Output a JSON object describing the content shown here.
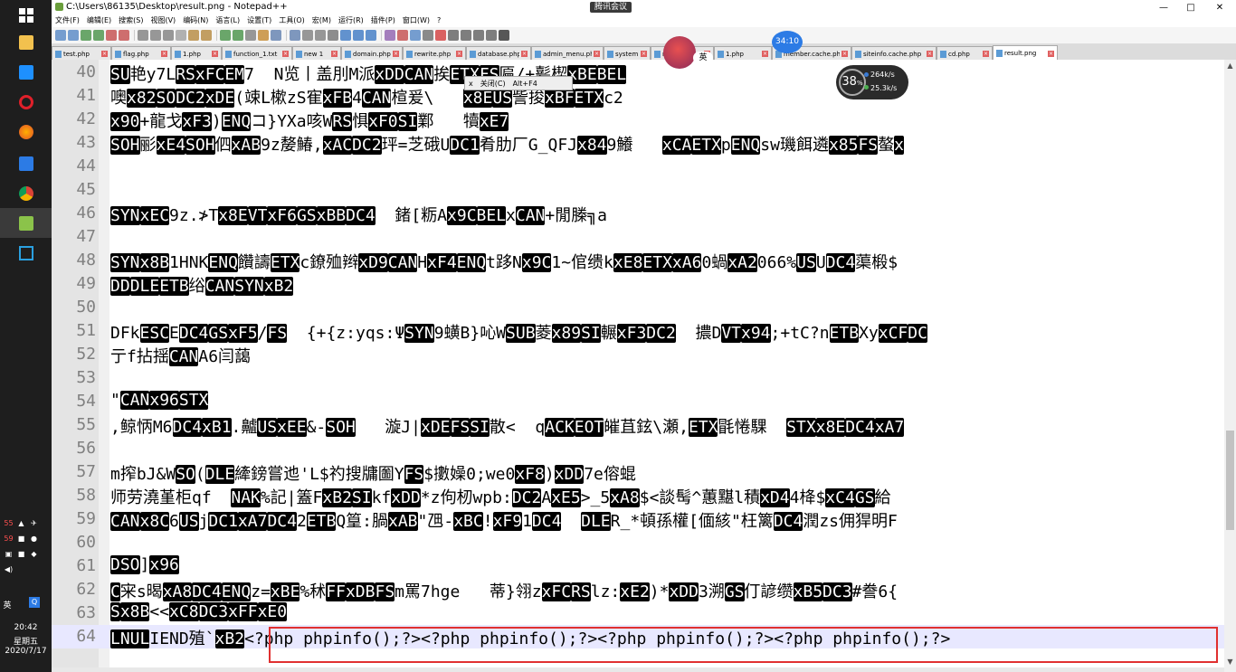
{
  "taskbar": {
    "tray_time": "20:42",
    "tray_weekday": "星期五",
    "tray_date": "2020/7/17",
    "ime": "英",
    "badge_a": "55",
    "badge_b": "59"
  },
  "window": {
    "title": "C:\\Users\\86135\\Desktop\\result.png - Notepad++",
    "meeting_label": "腾讯会议",
    "min": "—",
    "max": "□",
    "close": "✕"
  },
  "menu": [
    "文件(F)",
    "编辑(E)",
    "搜索(S)",
    "视图(V)",
    "编码(N)",
    "语言(L)",
    "设置(T)",
    "工具(O)",
    "宏(M)",
    "运行(R)",
    "插件(P)",
    "窗口(W)",
    "?"
  ],
  "tabs": [
    {
      "label": "test.php"
    },
    {
      "label": "flag.php"
    },
    {
      "label": "1.php"
    },
    {
      "label": "function_1.txt"
    },
    {
      "label": "new 1"
    },
    {
      "label": "domain.php"
    },
    {
      "label": "rewrite.php"
    },
    {
      "label": "database.php"
    },
    {
      "label": "admin_menu.php"
    },
    {
      "label": "system"
    },
    {
      "label": "m.php"
    },
    {
      "label": "1.php"
    },
    {
      "label": "member.cache.php"
    },
    {
      "label": "siteinfo.cache.php"
    },
    {
      "label": "cd.php"
    },
    {
      "label": "result.png"
    }
  ],
  "overlay": {
    "speed_pct": "38",
    "speed_pct_unit": "%",
    "speed_up": "264k/s",
    "speed_down": "25.3k/s",
    "ctx_label": "关闭(C)",
    "ctx_shortcut": "Alt+F4",
    "ctx_x": "x",
    "avatar_badge": "英",
    "timer": "34:10"
  },
  "lines": [
    {
      "n": "40",
      "segs": [
        [
          "b",
          "SU"
        ],
        [
          "t",
          "艳y7L"
        ],
        [
          "b",
          "RS"
        ],
        [
          "b",
          "xFC"
        ],
        [
          "b",
          "EM"
        ],
        [
          "t",
          "7  N览丨盖刖M派"
        ],
        [
          "b",
          "xDD"
        ],
        [
          "b",
          "CAN"
        ],
        [
          "t",
          "挨"
        ],
        [
          "b",
          "ETX"
        ],
        [
          "b",
          "FS"
        ],
        [
          "t",
          "匾/+甏楔"
        ],
        [
          "b",
          "xBE"
        ],
        [
          "b",
          "BEL"
        ]
      ]
    },
    {
      "n": "41",
      "segs": [
        [
          "t",
          "噢"
        ],
        [
          "b",
          "x82"
        ],
        [
          "b",
          "SO"
        ],
        [
          "b",
          "DC2"
        ],
        [
          "b",
          "xDE"
        ],
        [
          "t",
          "(竦L樕zS寉"
        ],
        [
          "b",
          "xFB"
        ],
        [
          "t",
          "4"
        ],
        [
          "b",
          "CAN"
        ],
        [
          "t",
          "楦爰\\   "
        ],
        [
          "b",
          "x8E"
        ],
        [
          "b",
          "US"
        ],
        [
          "t",
          "訾捘"
        ],
        [
          "b",
          "xBF"
        ],
        [
          "b",
          "ETX"
        ],
        [
          "t",
          "c2"
        ]
      ]
    },
    {
      "n": "42",
      "segs": [
        [
          "b",
          "x90"
        ],
        [
          "t",
          "+龍戈"
        ],
        [
          "b",
          "xF3"
        ],
        [
          "t",
          ")"
        ],
        [
          "b",
          "ENQ"
        ],
        [
          "t",
          "コ}YXa咳W"
        ],
        [
          "b",
          "RS"
        ],
        [
          "t",
          "惧"
        ],
        [
          "b",
          "xF0"
        ],
        [
          "b",
          "SI"
        ],
        [
          "t",
          "鄴   犢"
        ],
        [
          "b",
          "xE7"
        ]
      ]
    },
    {
      "n": "43",
      "segs": [
        [
          "b",
          "SOH"
        ],
        [
          "t",
          "彨"
        ],
        [
          "b",
          "xE4"
        ],
        [
          "b",
          "SOH"
        ],
        [
          "t",
          "伵"
        ],
        [
          "b",
          "xAB"
        ],
        [
          "t",
          "9z嫠鰆,"
        ],
        [
          "b",
          "xAC"
        ],
        [
          "b",
          "DC2"
        ],
        [
          "t",
          "玶=芝硪U"
        ],
        [
          "b",
          "DC1"
        ],
        [
          "t",
          "肴肋厂G_QFJ"
        ],
        [
          "b",
          "x84"
        ],
        [
          "t",
          "9鱶   "
        ],
        [
          "b",
          "xCA"
        ],
        [
          "b",
          "ETX"
        ],
        [
          "t",
          "p"
        ],
        [
          "b",
          "ENQ"
        ],
        [
          "t",
          "sw璣餌遴"
        ],
        [
          "b",
          "x85"
        ],
        [
          "b",
          "FS"
        ],
        [
          "t",
          "螯"
        ],
        [
          "b",
          "x"
        ]
      ]
    },
    {
      "n": "44",
      "segs": []
    },
    {
      "n": "45",
      "segs": []
    },
    {
      "n": "46",
      "segs": [
        [
          "b",
          "SYN"
        ],
        [
          "b",
          "xEC"
        ],
        [
          "t",
          "9z.≯T"
        ],
        [
          "b",
          "x8E"
        ],
        [
          "b",
          "VT"
        ],
        [
          "b",
          "xF6"
        ],
        [
          "b",
          "GS"
        ],
        [
          "b",
          "xBB"
        ],
        [
          "b",
          "DC4"
        ],
        [
          "t",
          "  鍺[粝A"
        ],
        [
          "b",
          "x9C"
        ],
        [
          "b",
          "BEL"
        ],
        [
          "t",
          "x"
        ],
        [
          "b",
          "CAN"
        ],
        [
          "t",
          "+閒榺╗a"
        ]
      ]
    },
    {
      "n": "47",
      "segs": []
    },
    {
      "n": "48",
      "segs": [
        [
          "b",
          "SYN"
        ],
        [
          "b",
          "x8B"
        ],
        [
          "t",
          "1HNK"
        ],
        [
          "b",
          "ENQ"
        ],
        [
          "t",
          "饡譸"
        ],
        [
          "b",
          "ETX"
        ],
        [
          "t",
          "c鐐殈辫"
        ],
        [
          "b",
          "xD9"
        ],
        [
          "b",
          "CAN"
        ],
        [
          "t",
          "H"
        ],
        [
          "b",
          "xF4"
        ],
        [
          "b",
          "ENQ"
        ],
        [
          "t",
          "t跢N"
        ],
        [
          "b",
          "x9C"
        ],
        [
          "t",
          "1~倌缋k"
        ],
        [
          "b",
          "xE8"
        ],
        [
          "b",
          "ETX"
        ],
        [
          "b",
          "xA6"
        ],
        [
          "t",
          "0蝸"
        ],
        [
          "b",
          "xA2"
        ],
        [
          "t",
          "066%"
        ],
        [
          "b",
          "US"
        ],
        [
          "t",
          "U"
        ],
        [
          "b",
          "DC4"
        ],
        [
          "t",
          "蕖椴$"
        ]
      ]
    },
    {
      "n": "49",
      "segs": [
        [
          "b",
          "DD"
        ],
        [
          "b",
          "DLE"
        ],
        [
          "b",
          "ETB"
        ],
        [
          "t",
          "绤"
        ],
        [
          "b",
          "CAN"
        ],
        [
          "b",
          "SYN"
        ],
        [
          "b",
          "xB2"
        ]
      ]
    },
    {
      "n": "50",
      "segs": []
    },
    {
      "n": "51",
      "segs": [
        [
          "t",
          "DFk"
        ],
        [
          "b",
          "ESC"
        ],
        [
          "t",
          "E"
        ],
        [
          "b",
          "DC4"
        ],
        [
          "b",
          "GS"
        ],
        [
          "b",
          "xF5"
        ],
        [
          "t",
          "/"
        ],
        [
          "b",
          "FS"
        ],
        [
          "t",
          "  {+{z:yqs:Ψ"
        ],
        [
          "b",
          "SYN"
        ],
        [
          "t",
          "9蟥B}吣W"
        ],
        [
          "b",
          "SUB"
        ],
        [
          "t",
          "菱"
        ],
        [
          "b",
          "x89"
        ],
        [
          "b",
          "SI"
        ],
        [
          "t",
          "輾"
        ],
        [
          "b",
          "xF3"
        ],
        [
          "b",
          "DC2"
        ],
        [
          "t",
          "  擃D"
        ],
        [
          "b",
          "VT"
        ],
        [
          "b",
          "x94"
        ],
        [
          "t",
          ";+tC?n"
        ],
        [
          "b",
          "ETB"
        ],
        [
          "t",
          "Xy"
        ],
        [
          "b",
          "xCF"
        ],
        [
          "b",
          "DC"
        ]
      ]
    },
    {
      "n": "52",
      "segs": [
        [
          "t",
          "亍f拈揺"
        ],
        [
          "b",
          "CAN"
        ],
        [
          "t",
          "A6闫藹"
        ]
      ]
    },
    {
      "n": "53",
      "segs": []
    },
    {
      "n": "54",
      "segs": [
        [
          "t",
          "\""
        ],
        [
          "b",
          "CAN"
        ],
        [
          "b",
          "x96"
        ],
        [
          "b",
          "STX"
        ]
      ]
    },
    {
      "n": "55",
      "segs": [
        [
          "t",
          ",鲸怲M6"
        ],
        [
          "b",
          "DC4"
        ],
        [
          "b",
          "xB1"
        ],
        [
          "t",
          ".齇"
        ],
        [
          "b",
          "US"
        ],
        [
          "b",
          "xEE"
        ],
        [
          "t",
          "&-"
        ],
        [
          "b",
          "SOH"
        ],
        [
          "t",
          "   漩J|"
        ],
        [
          "b",
          "xDE"
        ],
        [
          "b",
          "FS"
        ],
        [
          "b",
          "SI"
        ],
        [
          "t",
          "散<  q"
        ],
        [
          "b",
          "ACK"
        ],
        [
          "b",
          "EOT"
        ],
        [
          "t",
          "皠苴鉉\\瀬,"
        ],
        [
          "b",
          "ETX"
        ],
        [
          "t",
          "毷惓騍  "
        ],
        [
          "b",
          "STX"
        ],
        [
          "b",
          "x8E"
        ],
        [
          "b",
          "DC4"
        ],
        [
          "b",
          "xA7"
        ]
      ]
    },
    {
      "n": "56",
      "segs": []
    },
    {
      "n": "57",
      "segs": [
        [
          "t",
          "m搾bJ&W"
        ],
        [
          "b",
          "SO"
        ],
        [
          "t",
          "("
        ],
        [
          "b",
          "DLE"
        ],
        [
          "t",
          "縴鎊嘗迆'L$礿搜牗圗Y"
        ],
        [
          "b",
          "FS"
        ],
        [
          "t",
          "$擻嬠0;we0"
        ],
        [
          "b",
          "xF8"
        ],
        [
          "t",
          ")"
        ],
        [
          "b",
          "xDD"
        ],
        [
          "t",
          "7e傛蜫"
        ]
      ]
    },
    {
      "n": "58",
      "segs": [
        [
          "t",
          "师劳澆堇柜qf  "
        ],
        [
          "b",
          "NAK"
        ],
        [
          "t",
          "%記|篕F"
        ],
        [
          "b",
          "xB2"
        ],
        [
          "b",
          "SI"
        ],
        [
          "t",
          "kf"
        ],
        [
          "b",
          "xDD"
        ],
        [
          "t",
          "*z佝杒wpb:"
        ],
        [
          "b",
          "DC2"
        ],
        [
          "t",
          "A"
        ],
        [
          "b",
          "xE5"
        ],
        [
          "t",
          ">_5"
        ],
        [
          "b",
          "xA8"
        ],
        [
          "t",
          "$<談髩^蕙黮l積"
        ],
        [
          "b",
          "xD4"
        ],
        [
          "t",
          "4栙$"
        ],
        [
          "b",
          "xC4"
        ],
        [
          "b",
          "GS"
        ],
        [
          "t",
          "給"
        ]
      ]
    },
    {
      "n": "59",
      "segs": [
        [
          "b",
          "CAN"
        ],
        [
          "b",
          "x8C"
        ],
        [
          "t",
          "6"
        ],
        [
          "b",
          "US"
        ],
        [
          "t",
          "j"
        ],
        [
          "b",
          "DC1"
        ],
        [
          "b",
          "xA7"
        ],
        [
          "b",
          "DC4"
        ],
        [
          "t",
          "2"
        ],
        [
          "b",
          "ETB"
        ],
        [
          "t",
          "Q篁:腡"
        ],
        [
          "b",
          "xAB"
        ],
        [
          "t",
          "\"乪-"
        ],
        [
          "b",
          "xBC"
        ],
        [
          "t",
          "!"
        ],
        [
          "b",
          "xF9"
        ],
        [
          "t",
          "1"
        ],
        [
          "b",
          "DC4"
        ],
        [
          "t",
          "  "
        ],
        [
          "b",
          "DLE"
        ],
        [
          "t",
          "R_*頓孫權[偭絯\"枉篱"
        ],
        [
          "b",
          "DC4"
        ],
        [
          "t",
          "潤zs佣猂明F"
        ]
      ]
    },
    {
      "n": "60",
      "segs": []
    },
    {
      "n": "61",
      "segs": [
        [
          "b",
          "DSO"
        ],
        [
          "t",
          "]"
        ],
        [
          "b",
          "x96"
        ]
      ]
    },
    {
      "n": "62",
      "segs": [
        [
          "b",
          "C"
        ],
        [
          "t",
          "宩s暍"
        ],
        [
          "b",
          "xA8"
        ],
        [
          "b",
          "DC4"
        ],
        [
          "b",
          "ENQ"
        ],
        [
          "t",
          "z="
        ],
        [
          "b",
          "xBE"
        ],
        [
          "t",
          "%秫"
        ],
        [
          "b",
          "FF"
        ],
        [
          "b",
          "xDB"
        ],
        [
          "b",
          "FS"
        ],
        [
          "t",
          "m罵7hge   蒂}翎z"
        ],
        [
          "b",
          "xFC"
        ],
        [
          "b",
          "RS"
        ],
        [
          "t",
          "lz:"
        ],
        [
          "b",
          "xE2"
        ],
        [
          "t",
          ")*"
        ],
        [
          "b",
          "xDD"
        ],
        [
          "t",
          "3溯"
        ],
        [
          "b",
          "GS"
        ],
        [
          "t",
          "仃諺缵"
        ],
        [
          "b",
          "xB5"
        ],
        [
          "b",
          "DC3"
        ],
        [
          "t",
          "#誊6{"
        ]
      ]
    },
    {
      "n": "63",
      "segs": [
        [
          "b",
          "S"
        ],
        [
          "b",
          "x8B"
        ],
        [
          "t",
          "<<"
        ],
        [
          "b",
          "xC8"
        ],
        [
          "b",
          "DC3"
        ],
        [
          "b",
          "xFF"
        ],
        [
          "b",
          "xE0"
        ]
      ]
    },
    {
      "n": "64",
      "segs": [
        [
          "b",
          "LNUL"
        ],
        [
          "t",
          "IEND殖`"
        ],
        [
          "b",
          "xB2"
        ],
        [
          "t",
          "<?php phpinfo();?><?php phpinfo();?><?php phpinfo();?><?php phpinfo();?>"
        ]
      ]
    }
  ]
}
